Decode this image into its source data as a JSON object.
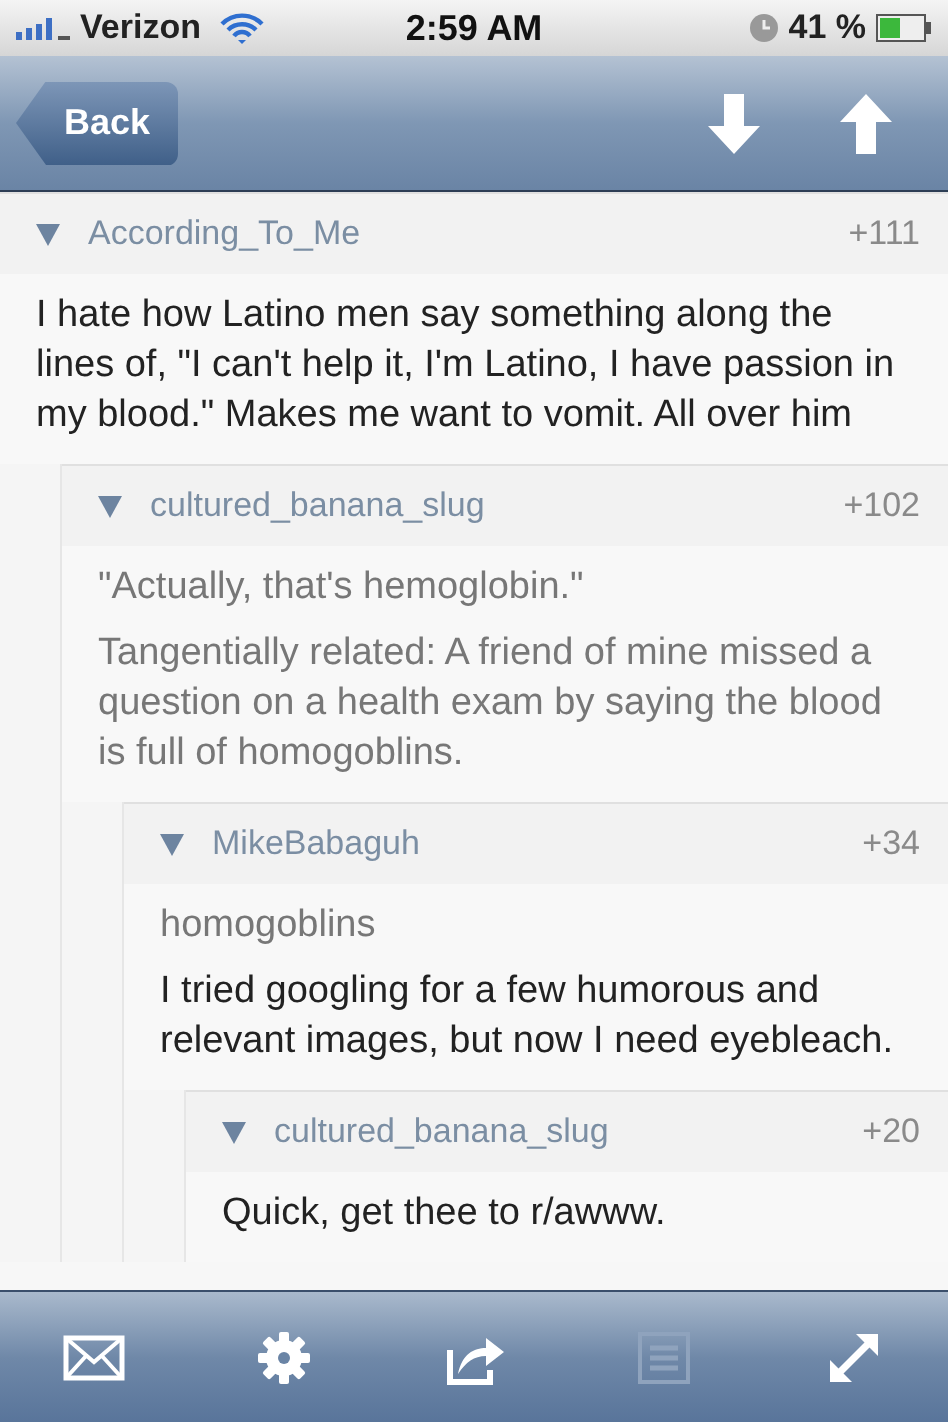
{
  "status_bar": {
    "carrier": "Verizon",
    "time": "2:59 AM",
    "battery": "41 %"
  },
  "nav_bar": {
    "back": "Back",
    "buttons": [
      {
        "kind": "down"
      },
      {
        "kind": "up"
      }
    ]
  },
  "comments": [
    {
      "author": "According_To_Me",
      "score": "+111",
      "expanded": true,
      "paragraphs": [
        {
          "kind": "text",
          "text": "I hate how Latino men say something along the lines of, \"I can't help it, I'm Latino, I have passion in my blood.\" Makes me want to vomit. All over him"
        }
      ],
      "children": [
        {
          "author": "cultured_banana_slug",
          "score": "+102",
          "expanded": true,
          "paragraphs": [
            {
              "kind": "quote",
              "text": "\"Actually, that's hemoglobin.\""
            },
            {
              "kind": "quote",
              "text": "Tangentially related: A friend of mine missed a question on a health exam by saying the blood is full of homogoblins."
            }
          ],
          "children": [
            {
              "author": "MikeBabaguh",
              "score": "+34",
              "expanded": true,
              "paragraphs": [
                {
                  "kind": "quote",
                  "text": "homogoblins"
                },
                {
                  "kind": "text",
                  "text": "I tried googling for a few humorous and relevant images, but now I need eyebleach."
                }
              ],
              "children": [
                {
                  "author": "cultured_banana_slug",
                  "score": "+20",
                  "expanded": true,
                  "paragraphs": [
                    {
                      "kind": "text",
                      "text": "Quick, get thee to r/awww."
                    }
                  ]
                }
              ]
            }
          ]
        }
      ]
    }
  ],
  "toolbar": [
    {
      "kind": "mail",
      "disabled": false
    },
    {
      "kind": "gear",
      "disabled": false
    },
    {
      "kind": "share",
      "disabled": false
    },
    {
      "kind": "list",
      "disabled": true
    },
    {
      "kind": "expand",
      "disabled": false
    }
  ]
}
